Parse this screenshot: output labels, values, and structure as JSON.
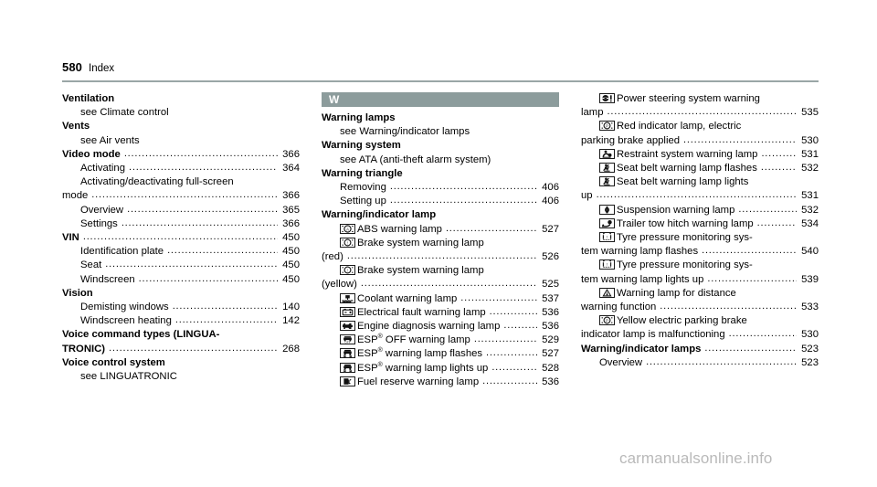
{
  "header": {
    "page_number": "580",
    "section": "Index"
  },
  "watermark": "carmanualsonline.info",
  "colors": {
    "letter_band_bg": "#8c9c9c",
    "rule": "#9aa6a6",
    "watermark": "#b9b9b9"
  },
  "columns": [
    {
      "id": "column-1",
      "blocks": [
        {
          "type": "entry",
          "bold": true,
          "indent": 0,
          "label": "Ventilation",
          "leader": false,
          "page": ""
        },
        {
          "type": "plain",
          "bold": false,
          "indent": 1,
          "label": "see Climate control"
        },
        {
          "type": "entry",
          "bold": true,
          "indent": 0,
          "label": "Vents",
          "leader": false,
          "page": ""
        },
        {
          "type": "plain",
          "bold": false,
          "indent": 1,
          "label": "see Air vents"
        },
        {
          "type": "entry",
          "bold": true,
          "indent": 0,
          "label": "Video mode",
          "leader": true,
          "page": "366"
        },
        {
          "type": "entry",
          "bold": false,
          "indent": 1,
          "label": "Activating",
          "leader": true,
          "page": "364"
        },
        {
          "type": "plain",
          "bold": false,
          "indent": 1,
          "label": "Activating/deactivating full-screen"
        },
        {
          "type": "entry",
          "bold": false,
          "indent": 0,
          "label": "mode",
          "leader": true,
          "page": "366"
        },
        {
          "type": "entry",
          "bold": false,
          "indent": 1,
          "label": "Overview",
          "leader": true,
          "page": "365"
        },
        {
          "type": "entry",
          "bold": false,
          "indent": 1,
          "label": "Settings",
          "leader": true,
          "page": "366"
        },
        {
          "type": "entry",
          "bold": true,
          "indent": 0,
          "label": "VIN",
          "leader": true,
          "page": "450"
        },
        {
          "type": "entry",
          "bold": false,
          "indent": 1,
          "label": "Identification plate",
          "leader": true,
          "page": "450"
        },
        {
          "type": "entry",
          "bold": false,
          "indent": 1,
          "label": "Seat",
          "leader": true,
          "page": "450"
        },
        {
          "type": "entry",
          "bold": false,
          "indent": 1,
          "label": "Windscreen",
          "leader": true,
          "page": "450"
        },
        {
          "type": "entry",
          "bold": true,
          "indent": 0,
          "label": "Vision",
          "leader": false,
          "page": ""
        },
        {
          "type": "entry",
          "bold": false,
          "indent": 1,
          "label": "Demisting windows",
          "leader": true,
          "page": "140"
        },
        {
          "type": "entry",
          "bold": false,
          "indent": 1,
          "label": "Windscreen heating",
          "leader": true,
          "page": "142"
        },
        {
          "type": "plain",
          "bold": true,
          "indent": 0,
          "label": "Voice command types (LINGUA-"
        },
        {
          "type": "entry",
          "bold": true,
          "indent": 0,
          "label": "TRONIC)",
          "leader": true,
          "page": "268"
        },
        {
          "type": "entry",
          "bold": true,
          "indent": 0,
          "label": "Voice control system",
          "leader": false,
          "page": ""
        },
        {
          "type": "plain",
          "bold": false,
          "indent": 1,
          "label": "see LINGUATRONIC"
        }
      ]
    },
    {
      "id": "column-2",
      "letter_band": "W",
      "blocks": [
        {
          "type": "entry",
          "bold": true,
          "indent": 0,
          "label": "Warning lamps",
          "leader": false,
          "page": ""
        },
        {
          "type": "plain",
          "bold": false,
          "indent": 1,
          "label": "see Warning/indicator lamps"
        },
        {
          "type": "entry",
          "bold": true,
          "indent": 0,
          "label": "Warning system",
          "leader": false,
          "page": ""
        },
        {
          "type": "plain",
          "bold": false,
          "indent": 1,
          "label": "see ATA (anti-theft alarm system)"
        },
        {
          "type": "entry",
          "bold": true,
          "indent": 0,
          "label": "Warning triangle",
          "leader": false,
          "page": ""
        },
        {
          "type": "entry",
          "bold": false,
          "indent": 1,
          "label": "Removing",
          "leader": true,
          "page": "406"
        },
        {
          "type": "entry",
          "bold": false,
          "indent": 1,
          "label": "Setting up",
          "leader": true,
          "page": "406"
        },
        {
          "type": "entry",
          "bold": true,
          "indent": 0,
          "label": "Warning/indicator lamp",
          "leader": false,
          "page": ""
        },
        {
          "type": "entry",
          "bold": false,
          "indent": 1,
          "icon": "abs-warning-lamp-icon",
          "label": "ABS warning lamp",
          "leader": true,
          "page": "527"
        },
        {
          "type": "plain",
          "bold": false,
          "indent": 1,
          "icon": "brake-system-warning-lamp-icon",
          "label": "Brake system warning lamp"
        },
        {
          "type": "entry",
          "bold": false,
          "indent": 0,
          "label": "(red)",
          "leader": true,
          "page": "526"
        },
        {
          "type": "plain",
          "bold": false,
          "indent": 1,
          "icon": "brake-system-warning-lamp-icon",
          "label": "Brake system warning lamp"
        },
        {
          "type": "entry",
          "bold": false,
          "indent": 0,
          "label": "(yellow)",
          "leader": true,
          "page": "525"
        },
        {
          "type": "entry",
          "bold": false,
          "indent": 1,
          "icon": "coolant-warning-lamp-icon",
          "label": "Coolant warning lamp",
          "leader": true,
          "page": "537"
        },
        {
          "type": "entry",
          "bold": false,
          "indent": 1,
          "icon": "electrical-fault-warning-lamp-icon",
          "label": "Electrical fault warning lamp",
          "leader": true,
          "page": "536"
        },
        {
          "type": "entry",
          "bold": false,
          "indent": 1,
          "icon": "engine-diagnosis-warning-lamp-icon",
          "label": "Engine diagnosis warning lamp",
          "leader": true,
          "page": "536"
        },
        {
          "type": "entry",
          "bold": false,
          "indent": 1,
          "icon": "esp-off-warning-lamp-icon",
          "label": "ESP® OFF warning lamp",
          "leader": true,
          "page": "529"
        },
        {
          "type": "entry",
          "bold": false,
          "indent": 1,
          "icon": "esp-warning-lamp-icon",
          "label": "ESP® warning lamp flashes",
          "leader": true,
          "page": "527"
        },
        {
          "type": "entry",
          "bold": false,
          "indent": 1,
          "icon": "esp-warning-lamp-icon",
          "label": "ESP® warning lamp lights up",
          "leader": true,
          "page": "528"
        },
        {
          "type": "entry",
          "bold": false,
          "indent": 1,
          "icon": "fuel-reserve-warning-lamp-icon",
          "label": "Fuel reserve warning lamp",
          "leader": true,
          "page": "536"
        }
      ]
    },
    {
      "id": "column-3",
      "blocks": [
        {
          "type": "plain",
          "bold": false,
          "indent": 1,
          "icon": "power-steering-warning-lamp-icon",
          "label": "Power steering system warning"
        },
        {
          "type": "entry",
          "bold": false,
          "indent": 0,
          "label": "lamp",
          "leader": true,
          "page": "535"
        },
        {
          "type": "plain",
          "bold": false,
          "indent": 1,
          "icon": "red-parking-brake-indicator-icon",
          "label": "Red indicator lamp, electric"
        },
        {
          "type": "entry",
          "bold": false,
          "indent": 0,
          "label": "parking brake applied",
          "leader": true,
          "page": "530"
        },
        {
          "type": "entry",
          "bold": false,
          "indent": 1,
          "icon": "restraint-system-warning-lamp-icon",
          "label": "Restraint system warning lamp",
          "leader": true,
          "page": "531"
        },
        {
          "type": "entry",
          "bold": false,
          "indent": 1,
          "icon": "seat-belt-warning-lamp-icon",
          "label": "Seat belt warning lamp flashes",
          "leader": true,
          "page": "532"
        },
        {
          "type": "plain",
          "bold": false,
          "indent": 1,
          "icon": "seat-belt-warning-lamp-icon",
          "label": "Seat belt warning lamp lights"
        },
        {
          "type": "entry",
          "bold": false,
          "indent": 0,
          "label": "up",
          "leader": true,
          "page": "531"
        },
        {
          "type": "entry",
          "bold": false,
          "indent": 1,
          "icon": "suspension-warning-lamp-icon",
          "label": "Suspension warning lamp",
          "leader": true,
          "page": "532"
        },
        {
          "type": "entry",
          "bold": false,
          "indent": 1,
          "icon": "trailer-tow-hitch-warning-lamp-icon",
          "label": "Trailer tow hitch warning lamp",
          "leader": true,
          "page": "534"
        },
        {
          "type": "plain",
          "bold": false,
          "indent": 1,
          "icon": "tyre-pressure-warning-lamp-icon",
          "label": "Tyre pressure monitoring sys-"
        },
        {
          "type": "entry",
          "bold": false,
          "indent": 0,
          "label": "tem warning lamp flashes",
          "leader": true,
          "page": "540"
        },
        {
          "type": "plain",
          "bold": false,
          "indent": 1,
          "icon": "tyre-pressure-warning-lamp-icon",
          "label": "Tyre pressure monitoring sys-"
        },
        {
          "type": "entry",
          "bold": false,
          "indent": 0,
          "label": "tem warning lamp lights up",
          "leader": true,
          "page": "539"
        },
        {
          "type": "plain",
          "bold": false,
          "indent": 1,
          "icon": "distance-warning-lamp-icon",
          "label": "Warning lamp for distance"
        },
        {
          "type": "entry",
          "bold": false,
          "indent": 0,
          "label": "warning function",
          "leader": true,
          "page": "533"
        },
        {
          "type": "plain",
          "bold": false,
          "indent": 1,
          "icon": "yellow-parking-brake-indicator-icon",
          "label": "Yellow electric parking brake"
        },
        {
          "type": "entry",
          "bold": false,
          "indent": 0,
          "label": "indicator lamp is malfunctioning",
          "leader": true,
          "page": "530"
        },
        {
          "type": "entry",
          "bold": true,
          "indent": 0,
          "label": "Warning/indicator lamps",
          "leader": true,
          "page": "523"
        },
        {
          "type": "entry",
          "bold": false,
          "indent": 1,
          "label": "Overview",
          "leader": true,
          "page": "523"
        }
      ]
    }
  ]
}
